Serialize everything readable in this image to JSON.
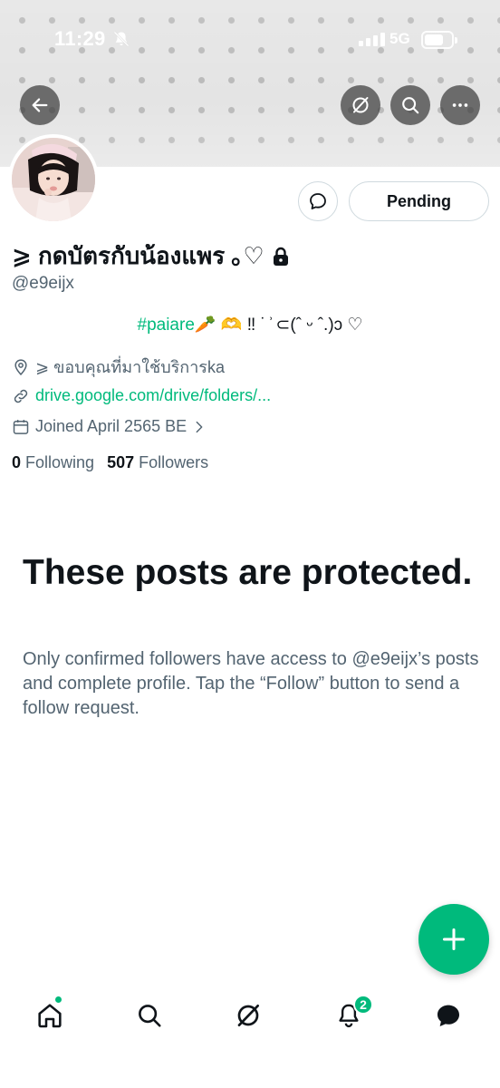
{
  "status_bar": {
    "time": "11:29",
    "network": "5G",
    "muted": true,
    "battery_level": 0.7
  },
  "top_actions": {
    "back_icon": "arrow-left-icon",
    "grok_icon": "grok-icon",
    "search_icon": "search-icon",
    "more_icon": "more-horizontal-icon"
  },
  "profile": {
    "display_name": "⩾ กดบัตรกับน้องแพร ｡♡",
    "protected": true,
    "handle": "@e9eijx",
    "message_button_icon": "message-bubble-icon",
    "follow_button_label": "Pending",
    "bio": {
      "hashtag": "#paiare",
      "rest": "🥕 🫶 ‼  ˙ ͗ ⊂(ˆ ᵕ ˆ.)ↄ ♡"
    },
    "location": "⩾ ขอบคุณที่มาใช้บริการka",
    "website": "drive.google.com/drive/folders/...",
    "joined": "Joined April 2565 BE",
    "following_count": "0",
    "following_label": "Following",
    "followers_count": "507",
    "followers_label": "Followers"
  },
  "protected_notice": {
    "title": "These posts are protected.",
    "body": "Only confirmed followers have access to @e9eijx’s posts and complete profile. Tap the “Follow” button to send a follow request."
  },
  "fab": {
    "icon": "plus-icon"
  },
  "bottom_nav": {
    "items": [
      "home-icon",
      "search-icon",
      "grok-icon",
      "notifications-icon",
      "messages-icon"
    ],
    "notification_badge": "2"
  },
  "colors": {
    "accent": "#00ba7c",
    "text_primary": "#0f1419",
    "text_secondary": "#536471",
    "border": "#cfd9de"
  }
}
